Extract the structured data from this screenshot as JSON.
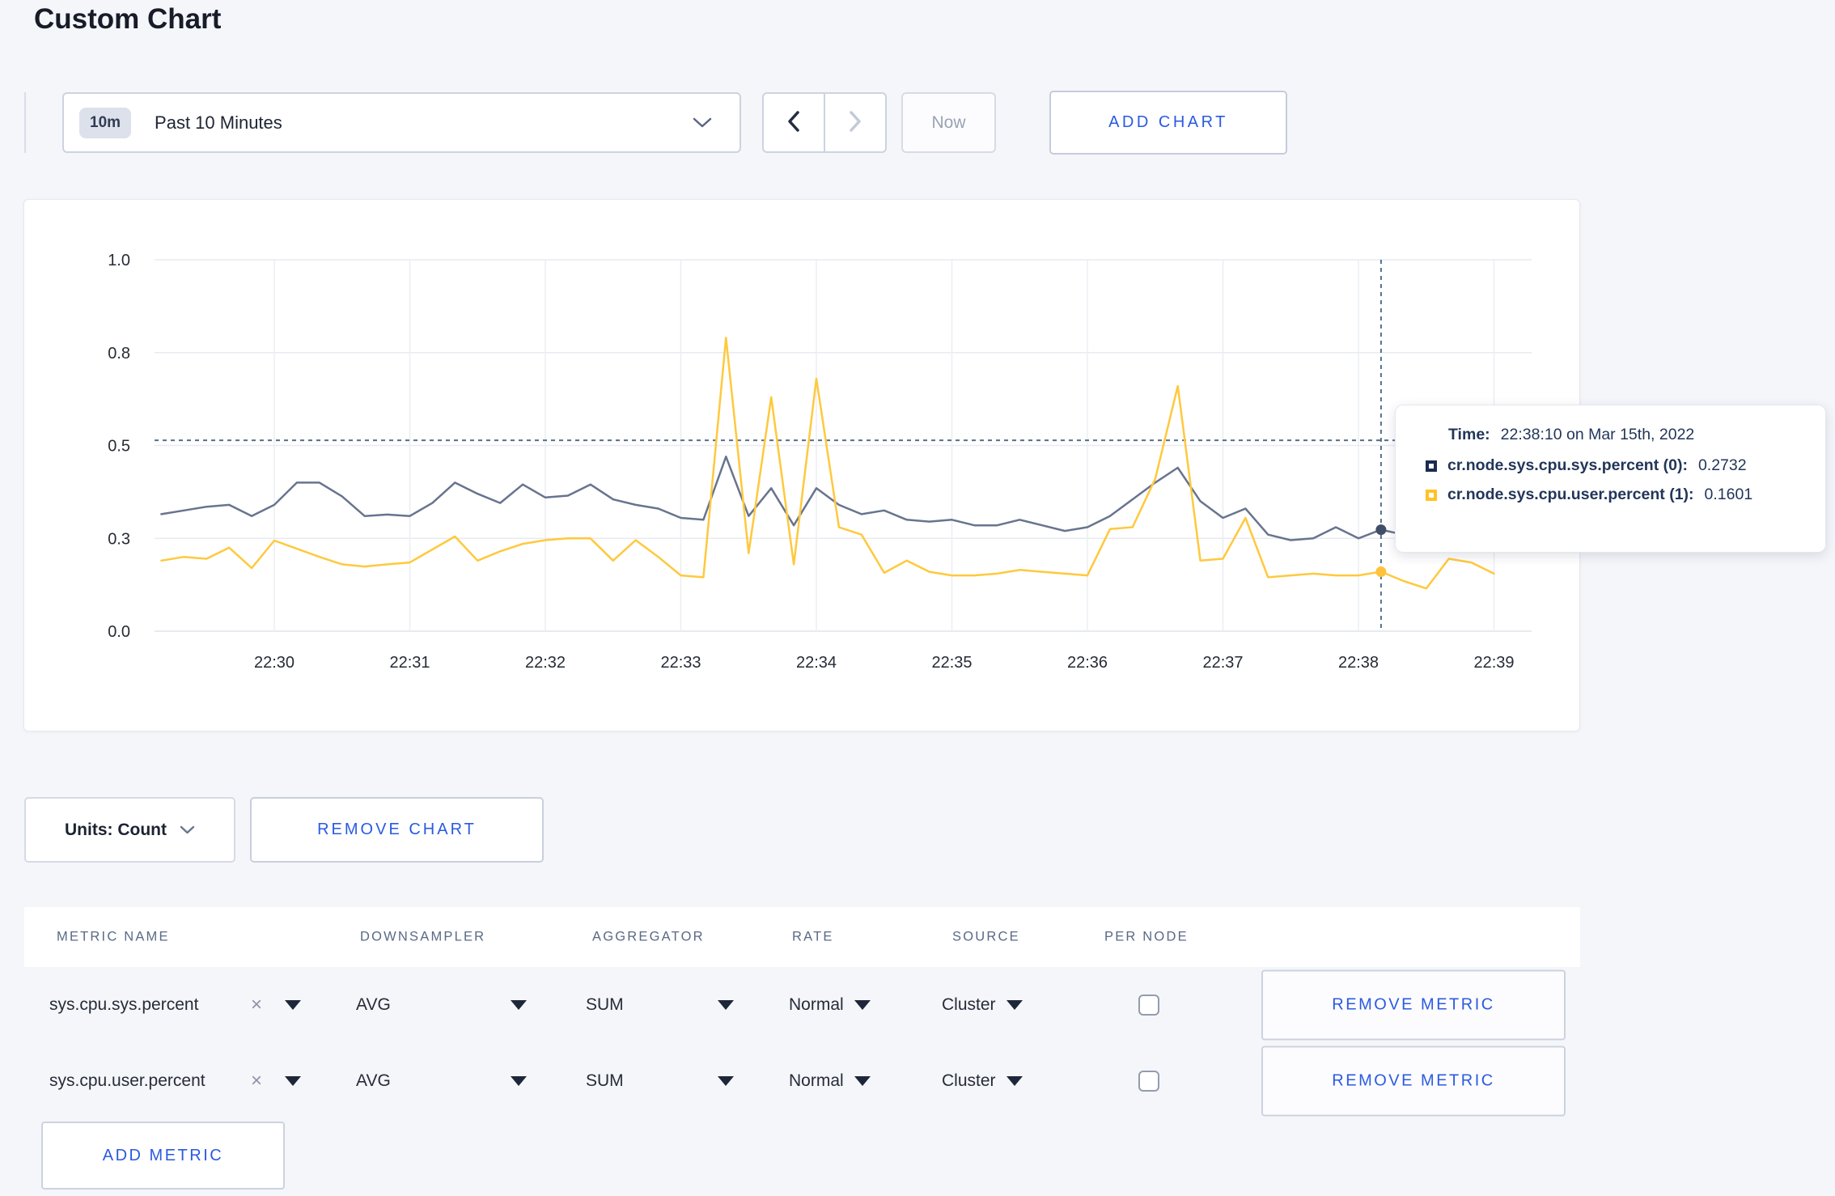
{
  "page_title": "Custom Chart",
  "colors": {
    "page_background": "#f5f6fa",
    "card_background": "#ffffff",
    "accent_blue": "#2a5ae0",
    "series_sys": "#68748e",
    "series_user": "#ffc93d",
    "crosshair": "#54708c",
    "gridline": "#e9ebf1"
  },
  "icons": {
    "time_dropdown": "chevron-down-icon",
    "prev": "chevron-left-icon",
    "next": "chevron-right-icon",
    "units": "chevron-down-icon",
    "metric_remove": "x-icon",
    "select_caret": "triangle-down-icon"
  },
  "toolbar": {
    "time_range_badge": "10m",
    "time_range_label": "Past 10 Minutes",
    "now_label": "Now",
    "add_chart_label": "ADD CHART"
  },
  "tooltip": {
    "time_label": "Time:",
    "time_value": "22:38:10 on Mar 15th, 2022",
    "series": [
      {
        "name": "cr.node.sys.cpu.sys.percent (0):",
        "value": "0.2732",
        "color": "#1b2b4f"
      },
      {
        "name": "cr.node.sys.cpu.user.percent (1):",
        "value": "0.1601",
        "color": "#ffc325"
      }
    ]
  },
  "chart_data": {
    "type": "line",
    "title": "",
    "xlabel": "",
    "ylabel": "",
    "ylim": [
      0,
      1
    ],
    "grid": true,
    "legend": "none",
    "x_ticks": [
      "22:30",
      "22:31",
      "22:32",
      "22:33",
      "22:34",
      "22:35",
      "22:36",
      "22:37",
      "22:38",
      "22:39"
    ],
    "y_tick_labels": [
      "0.0",
      "0.3",
      "0.5",
      "0.8",
      "1.0"
    ],
    "y_tick_values": [
      0,
      0.25,
      0.5,
      0.75,
      1.0
    ],
    "x_start": "22:29:10",
    "x_step_seconds": 10,
    "series": [
      {
        "name": "cr.node.sys.cpu.sys.percent",
        "color": "#68748e",
        "dot_color": "#414e68",
        "values": [
          0.315,
          0.325,
          0.335,
          0.34,
          0.31,
          0.34,
          0.4,
          0.4,
          0.363,
          0.31,
          0.314,
          0.31,
          0.345,
          0.4,
          0.37,
          0.345,
          0.395,
          0.36,
          0.365,
          0.395,
          0.355,
          0.34,
          0.33,
          0.305,
          0.3,
          0.47,
          0.31,
          0.385,
          0.285,
          0.385,
          0.34,
          0.315,
          0.325,
          0.3,
          0.295,
          0.3,
          0.285,
          0.285,
          0.3,
          0.285,
          0.27,
          0.28,
          0.31,
          0.355,
          0.4,
          0.44,
          0.35,
          0.305,
          0.33,
          0.26,
          0.245,
          0.25,
          0.28,
          0.25,
          0.2732,
          0.26,
          0.28,
          0.3,
          0.29,
          0.3
        ]
      },
      {
        "name": "cr.node.sys.cpu.user.percent",
        "color": "#ffc93d",
        "dot_color": "#ffc23a",
        "values": [
          0.19,
          0.2,
          0.195,
          0.225,
          0.17,
          0.244,
          0.222,
          0.2,
          0.18,
          0.174,
          0.18,
          0.185,
          0.22,
          0.255,
          0.19,
          0.215,
          0.235,
          0.245,
          0.25,
          0.25,
          0.19,
          0.245,
          0.2,
          0.15,
          0.145,
          0.79,
          0.21,
          0.63,
          0.18,
          0.68,
          0.28,
          0.26,
          0.157,
          0.19,
          0.16,
          0.15,
          0.15,
          0.155,
          0.165,
          0.16,
          0.155,
          0.15,
          0.275,
          0.28,
          0.41,
          0.66,
          0.19,
          0.195,
          0.305,
          0.145,
          0.15,
          0.155,
          0.15,
          0.15,
          0.1601,
          0.135,
          0.115,
          0.195,
          0.185,
          0.155
        ]
      }
    ],
    "crosshair": {
      "time": "22:38:10",
      "index": 54,
      "hline_value": 0.514
    }
  },
  "chart_footer": {
    "units_label": "Units: Count",
    "remove_chart_label": "REMOVE CHART"
  },
  "metrics_table": {
    "headers": [
      "METRIC NAME",
      "DOWNSAMPLER",
      "AGGREGATOR",
      "RATE",
      "SOURCE",
      "PER NODE"
    ],
    "rows": [
      {
        "name": "sys.cpu.sys.percent",
        "downsampler": "AVG",
        "aggregator": "SUM",
        "rate": "Normal",
        "source": "Cluster",
        "per_node_checked": false,
        "remove_label": "REMOVE METRIC"
      },
      {
        "name": "sys.cpu.user.percent",
        "downsampler": "AVG",
        "aggregator": "SUM",
        "rate": "Normal",
        "source": "Cluster",
        "per_node_checked": false,
        "remove_label": "REMOVE METRIC"
      }
    ],
    "add_metric_label": "ADD METRIC"
  }
}
